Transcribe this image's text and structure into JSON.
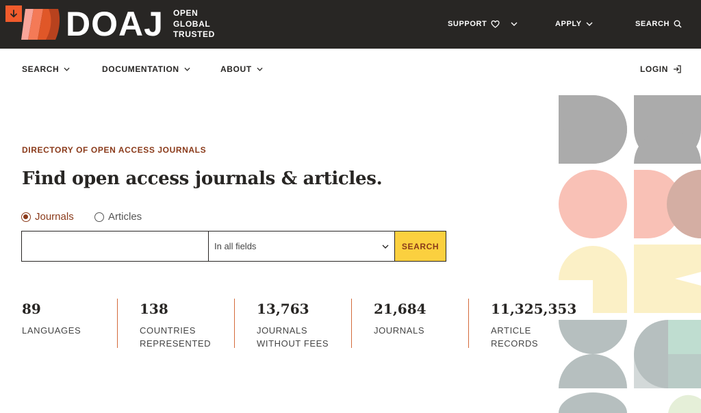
{
  "topbar": {
    "skip_icon": "arrow-down-icon",
    "brand": "DOAJ",
    "tagline": [
      "OPEN",
      "GLOBAL",
      "TRUSTED"
    ],
    "nav": [
      {
        "label": "SUPPORT",
        "icon": "heart-icon",
        "has_dropdown": true
      },
      {
        "label": "APPLY",
        "has_dropdown": true
      },
      {
        "label": "SEARCH",
        "icon": "search-icon"
      }
    ]
  },
  "secnav": {
    "search": "SEARCH",
    "documentation": "DOCUMENTATION",
    "about": "ABOUT",
    "login": "LOGIN"
  },
  "hero": {
    "eyebrow": "DIRECTORY OF OPEN ACCESS JOURNALS",
    "headline": "Find open access journals & articles.",
    "radio": {
      "journals": "Journals",
      "articles": "Articles",
      "selected": "Journals"
    },
    "search": {
      "query": "",
      "field": "In all fields",
      "button": "SEARCH"
    }
  },
  "stats": [
    {
      "value": "89",
      "label": "LANGUAGES"
    },
    {
      "value": "138",
      "label": "COUNTRIES REPRESENTED"
    },
    {
      "value": "13,763",
      "label": "JOURNALS WITHOUT FEES"
    },
    {
      "value": "21,684",
      "label": "JOURNALS"
    },
    {
      "value": "11,325,353",
      "label": "ARTICLE RECORDS"
    }
  ],
  "colors": {
    "header_bg": "#282624",
    "accent": "#f05b2c",
    "brand_brown": "#8a3a1a",
    "button_yellow": "#fbd03f",
    "divider": "#d46a3a"
  }
}
